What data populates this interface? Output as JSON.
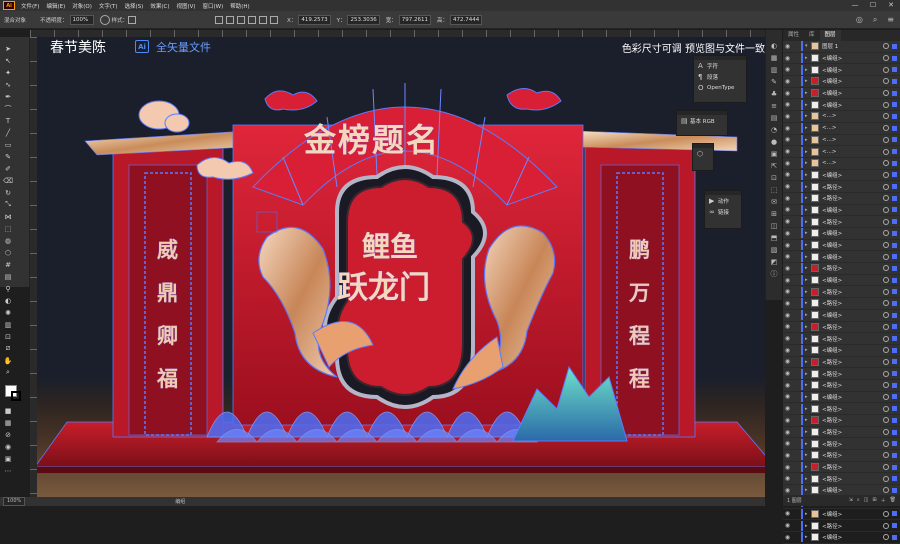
{
  "app": {
    "logo_text": "Ai"
  },
  "menu": [
    "文件(F)",
    "编辑(E)",
    "对象(O)",
    "文字(T)",
    "选择(S)",
    "效果(C)",
    "视图(V)",
    "窗口(W)",
    "帮助(H)"
  ],
  "window_controls": [
    "—",
    "☐",
    "✕"
  ],
  "control_bar": {
    "mixed_label": "混合对象",
    "opacity_label": "不透明度：",
    "opacity_value": "100%",
    "style_label": "样式：",
    "x_label": "X：",
    "x_value": "419.2573",
    "y_label": "Y：",
    "y_value": "253.3036",
    "w_label": "宽：",
    "w_value": "797.2611",
    "h_label": "高：",
    "h_value": "472.7444"
  },
  "canvas": {
    "title_cn": "春节美陈",
    "ai_badge": "Ai",
    "title_vector": "全矢量文件",
    "title_right": "色彩尺寸可调  预览图与文件一致",
    "headline": "金榜题名",
    "sub_line1": "鲤鱼",
    "sub_line2": "跃龙门",
    "left_pillar": [
      "威",
      "鼎",
      "卿",
      "福"
    ],
    "right_pillar": [
      "鹏",
      "万",
      "程",
      "程"
    ]
  },
  "float_panels": {
    "type": [
      "字符",
      "段落",
      "OpenType"
    ],
    "color": "基本 RGB",
    "actions": [
      "动作",
      "链接"
    ]
  },
  "layers_panel": {
    "tabs": [
      "属性",
      "库",
      "图层"
    ],
    "rows": [
      {
        "name": "图层 1",
        "thumb": "tan"
      },
      {
        "name": "<编组>",
        "thumb": "white"
      },
      {
        "name": "<编组>",
        "thumb": "white"
      },
      {
        "name": "<编组>",
        "thumb": "red"
      },
      {
        "name": "<编组>",
        "thumb": "red"
      },
      {
        "name": "<编组>",
        "thumb": "white"
      },
      {
        "name": "<...>",
        "thumb": "tan"
      },
      {
        "name": "<...>",
        "thumb": "tan"
      },
      {
        "name": "<...>",
        "thumb": "tan"
      },
      {
        "name": "<...>",
        "thumb": "tan"
      },
      {
        "name": "<...>",
        "thumb": "tan"
      },
      {
        "name": "<编组>",
        "thumb": "white"
      },
      {
        "name": "<路径>",
        "thumb": "white"
      },
      {
        "name": "<路径>",
        "thumb": "white"
      },
      {
        "name": "<编组>",
        "thumb": "white"
      },
      {
        "name": "<路径>",
        "thumb": "white"
      },
      {
        "name": "<编组>",
        "thumb": "white"
      },
      {
        "name": "<编组>",
        "thumb": "white"
      },
      {
        "name": "<编组>",
        "thumb": "white"
      },
      {
        "name": "<路径>",
        "thumb": "red"
      },
      {
        "name": "<编组>",
        "thumb": "white"
      },
      {
        "name": "<路径>",
        "thumb": "red"
      },
      {
        "name": "<路径>",
        "thumb": "white"
      },
      {
        "name": "<编组>",
        "thumb": "white"
      },
      {
        "name": "<路径>",
        "thumb": "red"
      },
      {
        "name": "<路径>",
        "thumb": "white"
      },
      {
        "name": "<编组>",
        "thumb": "white"
      },
      {
        "name": "<路径>",
        "thumb": "red"
      },
      {
        "name": "<路径>",
        "thumb": "white"
      },
      {
        "name": "<路径>",
        "thumb": "white"
      },
      {
        "name": "<编组>",
        "thumb": "white"
      },
      {
        "name": "<路径>",
        "thumb": "white"
      },
      {
        "name": "<路径>",
        "thumb": "red"
      },
      {
        "name": "<路径>",
        "thumb": "white"
      },
      {
        "name": "<路径>",
        "thumb": "white"
      },
      {
        "name": "<路径>",
        "thumb": "white"
      },
      {
        "name": "<路径>",
        "thumb": "red"
      },
      {
        "name": "<路径>",
        "thumb": "white"
      },
      {
        "name": "<编组>",
        "thumb": "white"
      },
      {
        "name": "<路径>",
        "thumb": "white"
      },
      {
        "name": "<编组>",
        "thumb": "tan"
      },
      {
        "name": "<路径>",
        "thumb": "white"
      },
      {
        "name": "<编组>",
        "thumb": "white"
      }
    ],
    "footer": "1 图层"
  },
  "status_bar": {
    "zoom": "100%",
    "status": "编组"
  },
  "colors": {
    "accent_blue": "#4c6ef5",
    "stage_red": "#c81e2a",
    "gold": "#e8c49a"
  }
}
